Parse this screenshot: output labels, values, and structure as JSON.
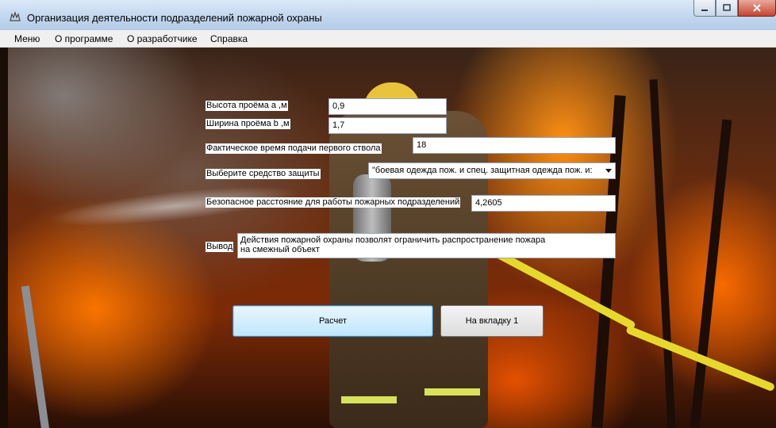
{
  "window": {
    "title": "Организация деятельности подразделений пожарной охраны",
    "icon": "app-icon"
  },
  "menu": {
    "items": [
      "Меню",
      "О программе",
      "О разработчике",
      "Справка"
    ]
  },
  "form": {
    "height": {
      "label": "Высота проёма a ,м",
      "value": "0,9"
    },
    "width": {
      "label": "Ширина проёма b ,м",
      "value": "1,7"
    },
    "time": {
      "label": "Фактическое время подачи первого ствола",
      "value": "18"
    },
    "protection": {
      "label": "Выберите средство защиты",
      "selected": "\"боевая одежда пож. и спец. защитная одежда пож. и:"
    },
    "distance": {
      "label": "Безопасное расстояние для работы пожарных подразделений",
      "value": "4,2605"
    },
    "output": {
      "label": "Вывод",
      "value": "Действия пожарной охраны позволят ограничить распространение пожара\nна смежный объект"
    }
  },
  "buttons": {
    "calculate": "Расчет",
    "to_tab1": "На вкладку 1"
  },
  "colors": {
    "primary_button_border": "#3c7fb1",
    "hose": "#e6d92c",
    "titlebar": "#c6daf0"
  }
}
